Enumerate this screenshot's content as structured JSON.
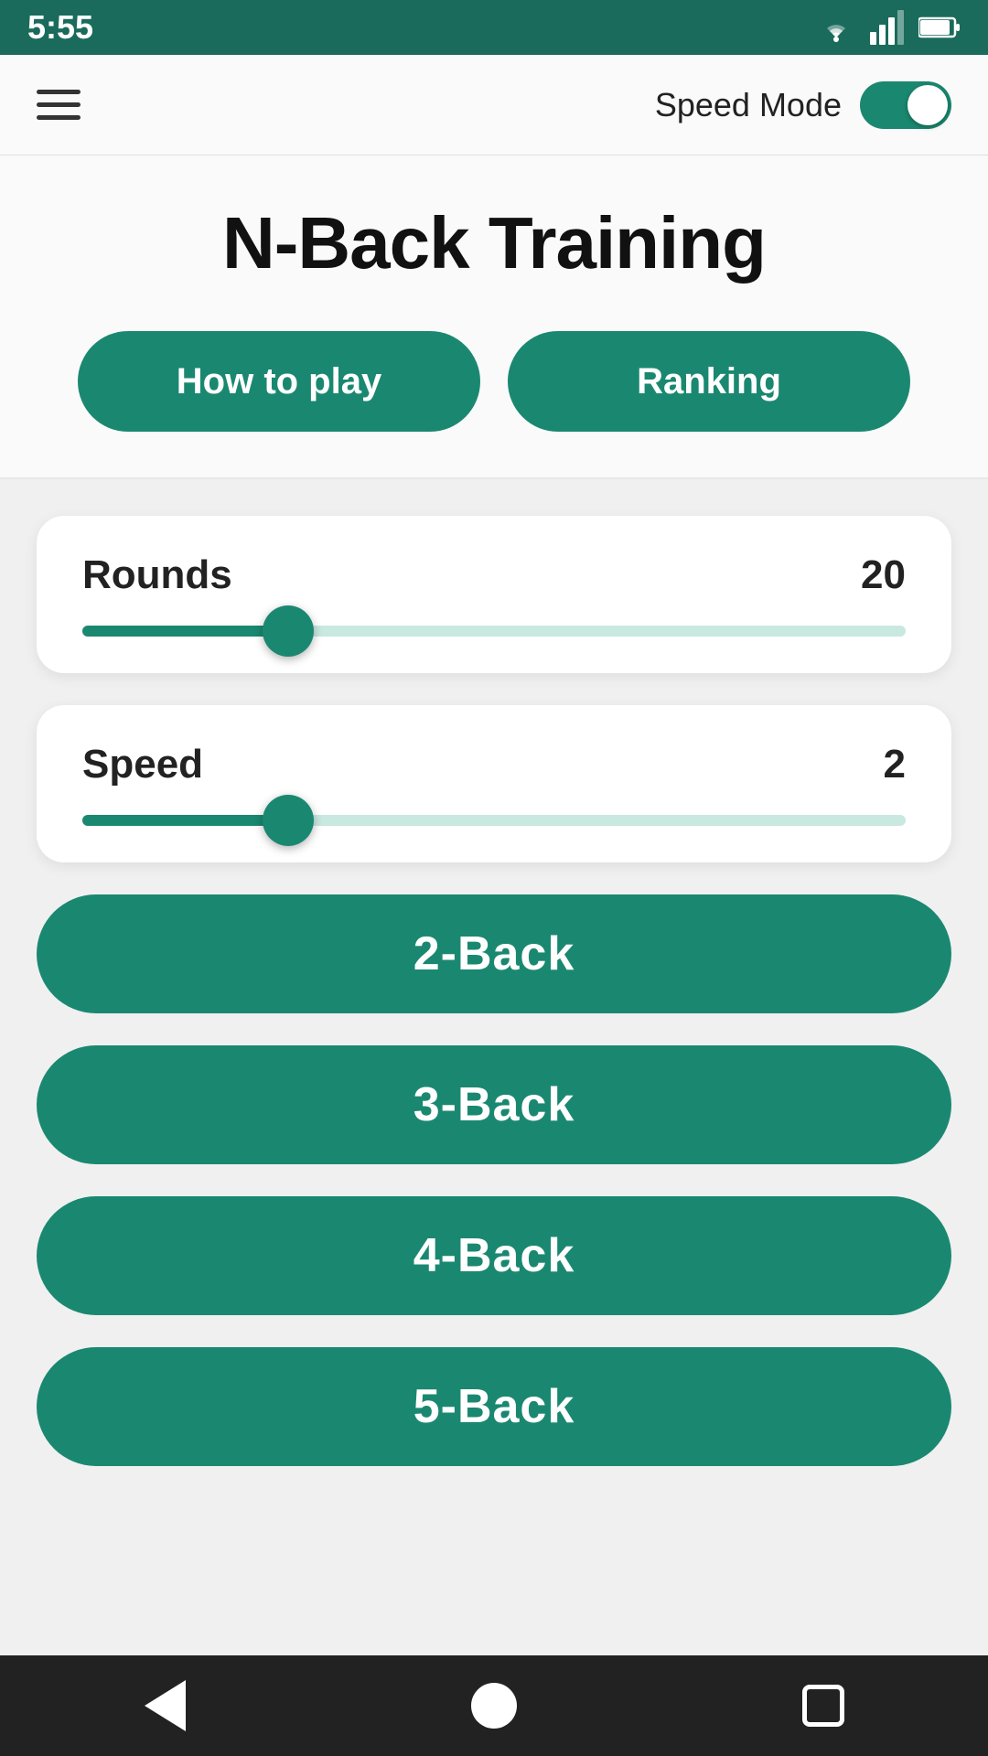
{
  "status_bar": {
    "time": "5:55",
    "wifi_icon": "wifi",
    "signal_icon": "signal",
    "battery_icon": "battery"
  },
  "top_bar": {
    "menu_icon": "hamburger",
    "speed_mode_label": "Speed Mode",
    "toggle_enabled": true
  },
  "header": {
    "title": "N-Back Training",
    "how_to_play_label": "How to play",
    "ranking_label": "Ranking"
  },
  "rounds_slider": {
    "label": "Rounds",
    "value": "20",
    "fill_percent": 25
  },
  "speed_slider": {
    "label": "Speed",
    "value": "2",
    "fill_percent": 25
  },
  "game_buttons": [
    {
      "label": "2-Back"
    },
    {
      "label": "3-Back"
    },
    {
      "label": "4-Back"
    },
    {
      "label": "5-Back"
    }
  ],
  "nav_bar": {
    "back_icon": "back",
    "home_icon": "home",
    "square_icon": "recent"
  },
  "colors": {
    "primary": "#1a8870",
    "background": "#f0f0f0",
    "card": "#ffffff",
    "text_dark": "#111111",
    "status_bar": "#1a6b5c"
  }
}
